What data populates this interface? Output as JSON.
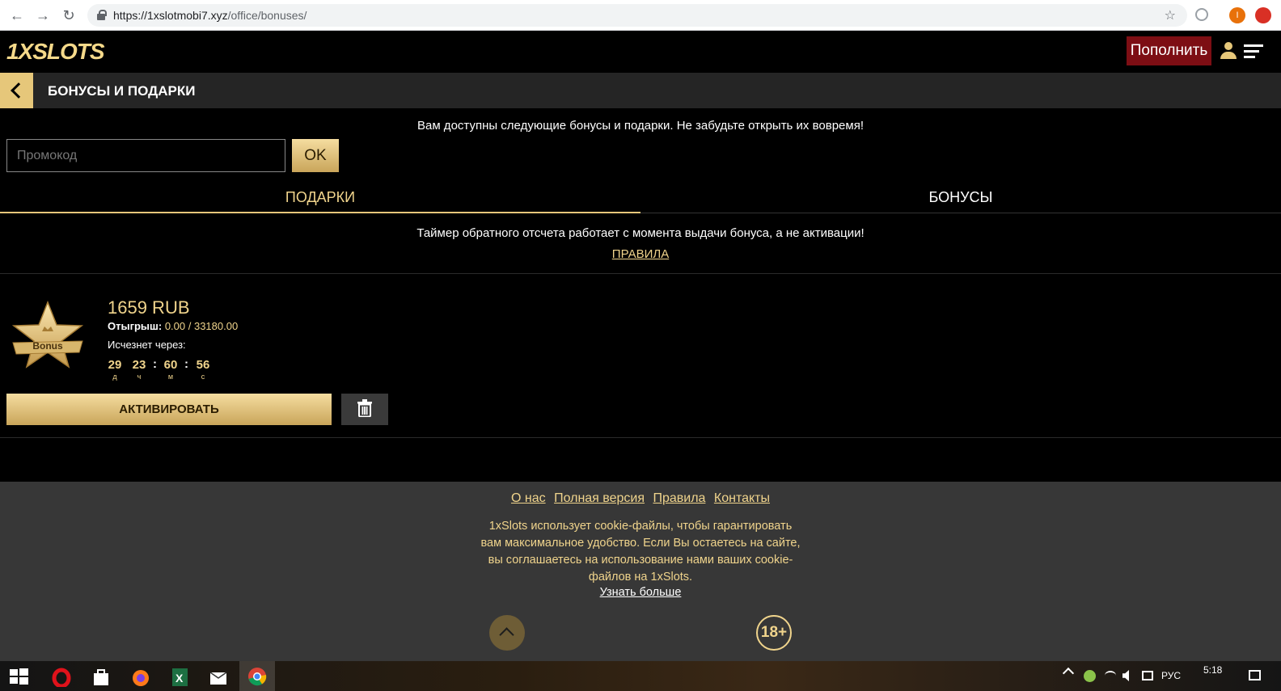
{
  "browser": {
    "url_host": "https://1xslotmobi7.xyz",
    "url_path": "/office/bonuses/",
    "profile_initial": "I"
  },
  "header": {
    "logo": "1XSLOTS",
    "deposit_label": "Пополнить"
  },
  "section": {
    "title": "БОНУСЫ И ПОДАРКИ"
  },
  "intro_text": "Вам доступны следующие бонусы и подарки. Не забудьте открыть их вовремя!",
  "promo": {
    "placeholder": "Промокод",
    "ok_label": "OK"
  },
  "tabs": {
    "gifts": "ПОДАРКИ",
    "bonuses": "БОНУСЫ"
  },
  "notice": "Таймер обратного отсчета работает с момента выдачи бонуса, а не активации!",
  "rules_link": "ПРАВИЛА",
  "bonus": {
    "badge_text": "Bonus",
    "amount": "1659 RUB",
    "wager_label": "Отыгрыш:",
    "wager_value": "0.00 / 33180.00",
    "expires_label": "Исчезнет через:",
    "timer": {
      "days": "29",
      "days_unit": "д",
      "hours": "23",
      "hours_unit": "ч",
      "minutes": "60",
      "minutes_unit": "м",
      "seconds": "56",
      "seconds_unit": "с",
      "separator": ":"
    },
    "activate_label": "АКТИВИРОВАТЬ"
  },
  "footer": {
    "links": [
      "О нас",
      "Полная версия",
      "Правила",
      "Контакты"
    ],
    "cookie_text": "1xSlots использует cookie-файлы, чтобы гарантировать вам максимальное удобство. Если Вы остаетесь на сайте, вы соглашаетесь на использование нами ваших cookie-файлов на 1xSlots.",
    "learn_more": "Узнать больше",
    "age": "18+"
  },
  "taskbar": {
    "lang": "РУС",
    "time": "5:18"
  },
  "colors": {
    "gold": "#f0d48c",
    "deposit": "#7d0e14",
    "panel": "#252525",
    "footer": "#373737"
  }
}
